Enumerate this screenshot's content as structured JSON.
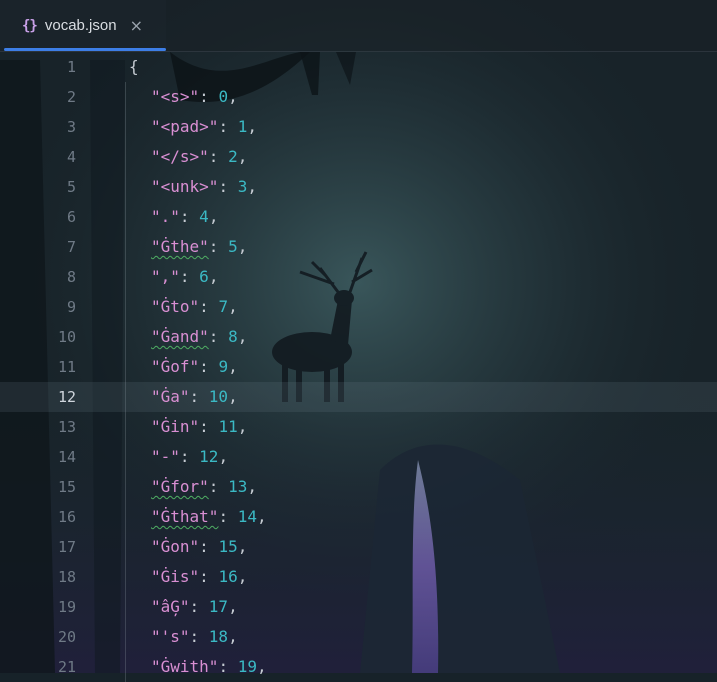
{
  "tab": {
    "icon": "braces-icon",
    "filename": "vocab.json",
    "close": "×"
  },
  "editor": {
    "current_line": 12,
    "open_brace": "{",
    "lines": [
      {
        "num": "1"
      },
      {
        "num": "2",
        "key": "\"<s>\"",
        "value": "0",
        "spell": false
      },
      {
        "num": "3",
        "key": "\"<pad>\"",
        "value": "1",
        "spell": false
      },
      {
        "num": "4",
        "key": "\"</s>\"",
        "value": "2",
        "spell": false
      },
      {
        "num": "5",
        "key": "\"<unk>\"",
        "value": "3",
        "spell": false
      },
      {
        "num": "6",
        "key": "\".\"",
        "value": "4",
        "spell": false
      },
      {
        "num": "7",
        "key": "\"Ġthe\"",
        "value": "5",
        "spell": true
      },
      {
        "num": "8",
        "key": "\",\"",
        "value": "6",
        "spell": false
      },
      {
        "num": "9",
        "key": "\"Ġto\"",
        "value": "7",
        "spell": false
      },
      {
        "num": "10",
        "key": "\"Ġand\"",
        "value": "8",
        "spell": true
      },
      {
        "num": "11",
        "key": "\"Ġof\"",
        "value": "9",
        "spell": false
      },
      {
        "num": "12",
        "key": "\"Ġa\"",
        "value": "10",
        "spell": false
      },
      {
        "num": "13",
        "key": "\"Ġin\"",
        "value": "11",
        "spell": false
      },
      {
        "num": "14",
        "key": "\"-\"",
        "value": "12",
        "spell": false
      },
      {
        "num": "15",
        "key": "\"Ġfor\"",
        "value": "13",
        "spell": true
      },
      {
        "num": "16",
        "key": "\"Ġthat\"",
        "value": "14",
        "spell": true
      },
      {
        "num": "17",
        "key": "\"Ġon\"",
        "value": "15",
        "spell": false
      },
      {
        "num": "18",
        "key": "\"Ġis\"",
        "value": "16",
        "spell": false
      },
      {
        "num": "19",
        "key": "\"âĢ\"",
        "value": "17",
        "spell": false
      },
      {
        "num": "20",
        "key": "\"'s\"",
        "value": "18",
        "spell": false
      },
      {
        "num": "21",
        "key": "\"Ġwith\"",
        "value": "19",
        "spell": false
      }
    ]
  },
  "colors": {
    "key": "#d98fd3",
    "number": "#3bb9c4",
    "punctuation": "#c5cbd2",
    "line_number": "#6f7a86",
    "tab_underline": "#3d7ee6",
    "spellcheck": "#4fae63"
  },
  "background": "dark-forest-deer-waterfall"
}
